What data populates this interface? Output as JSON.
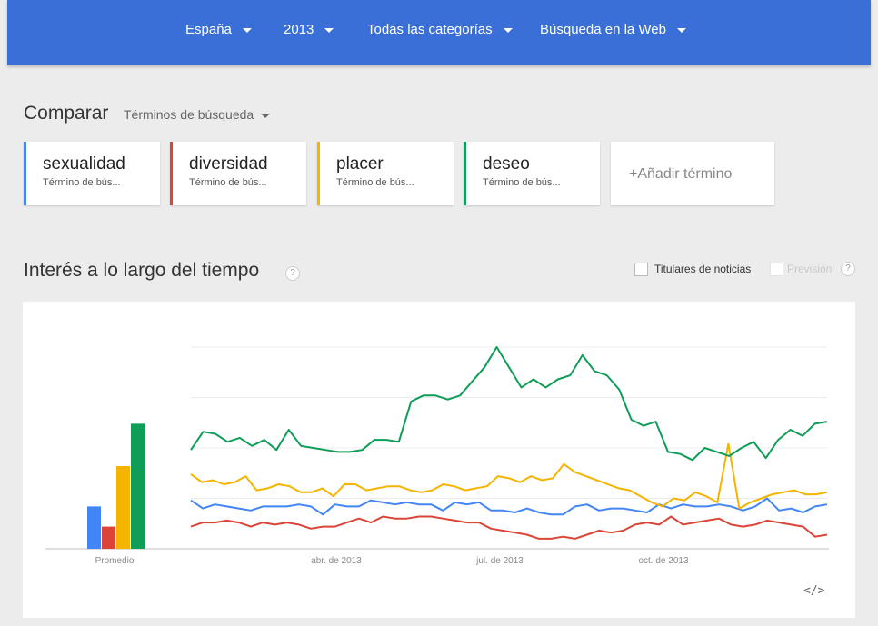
{
  "topbar": {
    "country": "España",
    "year": "2013",
    "category": "Todas las categorías",
    "search_type": "Búsqueda en la Web"
  },
  "compare": {
    "title": "Comparar",
    "subtitle": "Términos de búsqueda"
  },
  "terms": [
    {
      "name": "sexualidad",
      "type": "Término de bús...",
      "color": "#4285f4"
    },
    {
      "name": "diversidad",
      "type": "Término de bús...",
      "color": "#db4437"
    },
    {
      "name": "placer",
      "type": "Término de bús...",
      "color": "#f4b400"
    },
    {
      "name": "deseo",
      "type": "Término de bús...",
      "color": "#0f9d58"
    }
  ],
  "add_term": "+Añadir término",
  "interest": {
    "title": "Interés a lo largo del tiempo",
    "help": "?",
    "news_label": "Titulares de noticias",
    "forecast_label": "Previsión",
    "forecast_help": "?"
  },
  "embed_label": "</>",
  "chart_data": {
    "type": "line",
    "averages_bar": {
      "label": "Promedio",
      "values": [
        21,
        11,
        41,
        62
      ]
    },
    "x_ticks": [
      "abr. de 2013",
      "jul. de 2013",
      "oct. de 2013"
    ],
    "ylim": [
      0,
      100
    ],
    "grid": true,
    "series": [
      {
        "name": "sexualidad",
        "color": "#4285f4",
        "values": [
          24,
          20,
          22,
          21,
          20,
          19,
          21,
          21,
          21,
          22,
          21,
          17,
          22,
          21,
          21,
          24,
          23,
          22,
          23,
          22,
          22,
          19,
          23,
          22,
          23,
          19,
          19,
          18,
          20,
          18,
          17,
          17,
          21,
          22,
          19,
          20,
          20,
          19,
          18,
          22,
          20,
          22,
          21,
          21,
          22,
          21,
          19,
          21,
          25,
          19,
          20,
          18,
          21,
          22
        ]
      },
      {
        "name": "diversidad",
        "color": "#db4437",
        "values": [
          11,
          13,
          13,
          14,
          13,
          11,
          13,
          12,
          13,
          12,
          10,
          11,
          11,
          13,
          15,
          13,
          16,
          15,
          15,
          16,
          16,
          15,
          14,
          13,
          13,
          10,
          9,
          8,
          7,
          5,
          5,
          6,
          5,
          7,
          9,
          8,
          9,
          12,
          13,
          12,
          16,
          12,
          13,
          14,
          15,
          12,
          11,
          12,
          14,
          13,
          12,
          11,
          6,
          7
        ]
      },
      {
        "name": "placer",
        "color": "#f4b400",
        "values": [
          37,
          33,
          34,
          32,
          33,
          36,
          29,
          30,
          32,
          31,
          28,
          28,
          30,
          26,
          32,
          32,
          29,
          30,
          31,
          31,
          29,
          28,
          29,
          32,
          31,
          29,
          30,
          31,
          36,
          35,
          33,
          36,
          34,
          35,
          42,
          38,
          36,
          34,
          32,
          30,
          29,
          26,
          23,
          21,
          25,
          24,
          28,
          26,
          23,
          52,
          20,
          23,
          25,
          27,
          28,
          29,
          27,
          27,
          28
        ]
      },
      {
        "name": "deseo",
        "color": "#0f9d58",
        "values": [
          49,
          58,
          57,
          53,
          55,
          51,
          54,
          49,
          59,
          51,
          50,
          49,
          48,
          48,
          49,
          54,
          54,
          53,
          73,
          76,
          76,
          74,
          76,
          83,
          90,
          100,
          90,
          80,
          84,
          80,
          84,
          86,
          96,
          88,
          86,
          79,
          64,
          61,
          63,
          48,
          47,
          44,
          50,
          48,
          46,
          50,
          53,
          45,
          54,
          59,
          56,
          62,
          63
        ]
      }
    ]
  }
}
